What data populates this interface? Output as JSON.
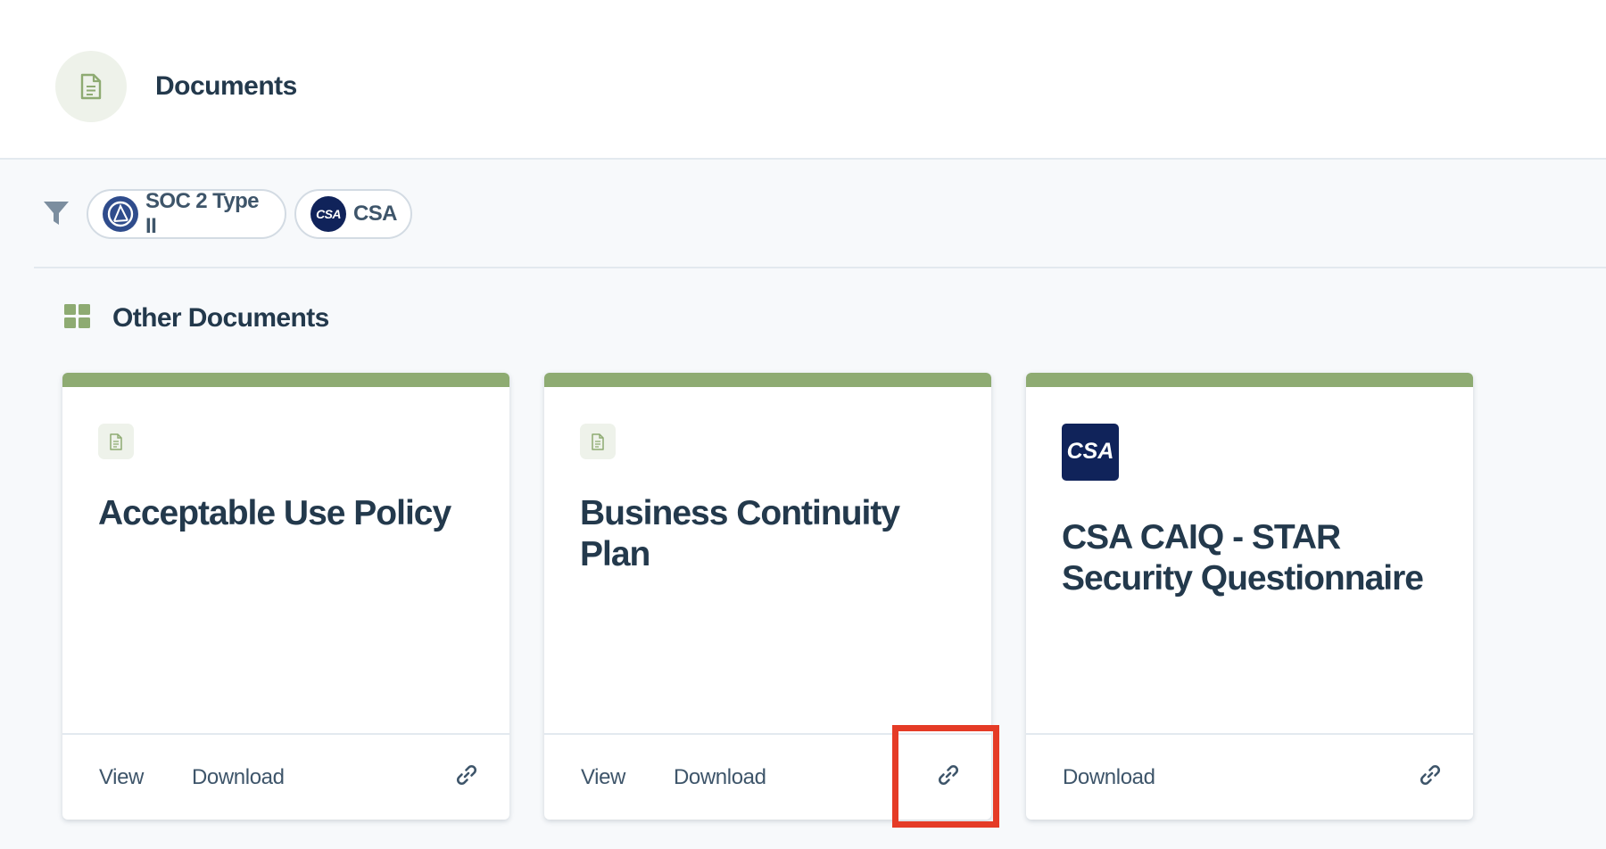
{
  "header": {
    "title": "Documents",
    "icon": "document-icon"
  },
  "filters": {
    "icon": "filter-icon",
    "chips": [
      {
        "label": "SOC 2 Type II",
        "icon": "soc2-logo-icon"
      },
      {
        "label": "CSA",
        "icon": "csa-logo-icon",
        "logo_text": "CSA"
      }
    ]
  },
  "section": {
    "title": "Other Documents",
    "icon": "grid-icon"
  },
  "cards": [
    {
      "title": "Acceptable Use Policy",
      "icon": "document-icon",
      "actions": {
        "view": "View",
        "download": "Download"
      },
      "link_icon": "link-icon"
    },
    {
      "title": "Business Continuity Plan",
      "icon": "document-icon",
      "actions": {
        "view": "View",
        "download": "Download"
      },
      "link_icon": "link-icon"
    },
    {
      "title": "CSA CAIQ - STAR Security Questionnaire",
      "icon": "csa-logo-icon",
      "logo_text": "CSA",
      "actions": {
        "download": "Download"
      },
      "link_icon": "link-icon"
    }
  ],
  "colors": {
    "accent_green": "#8eab72",
    "text_dark": "#23394c",
    "csa_navy": "#10235a",
    "highlight_red": "#e53b26"
  }
}
